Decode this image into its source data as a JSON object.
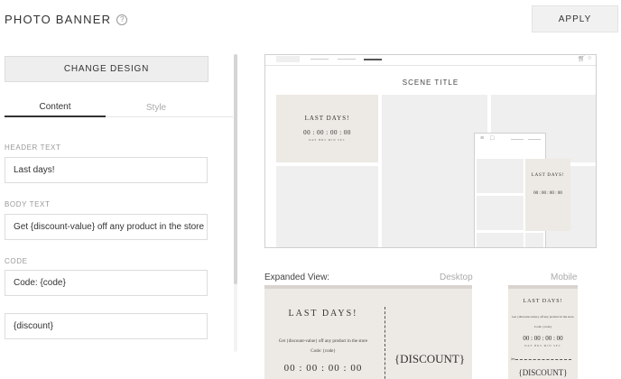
{
  "header": {
    "title": "PHOTO BANNER",
    "help_icon": "?",
    "apply_label": "APPLY"
  },
  "left_panel": {
    "change_design_label": "CHANGE DESIGN",
    "tabs": [
      {
        "label": "Content",
        "active": true
      },
      {
        "label": "Style",
        "active": false
      }
    ],
    "fields": {
      "header_text": {
        "label": "HEADER TEXT",
        "value": "Last days!"
      },
      "body_text": {
        "label": "BODY TEXT",
        "value": "Get {discount-value} off any product in the store"
      },
      "code": {
        "label": "CODE",
        "value": "Code: {code}"
      },
      "discount": {
        "value": "{discount}"
      }
    }
  },
  "preview": {
    "scene_title": "SCENE TITLE",
    "banner": {
      "heading": "LAST DAYS!",
      "countdown": "00 : 00 : 00 : 00",
      "countdown_units": "DAY  HRS  MIN  SEC"
    },
    "mobile_banner": {
      "heading": "LAST DAYS!",
      "countdown": "00 : 00 : 00 : 00"
    }
  },
  "expanded": {
    "label": "Expanded View:",
    "desktop_label": "Desktop",
    "mobile_label": "Mobile",
    "desktop": {
      "heading": "LAST DAYS!",
      "body": "Get {discount-value} off any product in the store",
      "code": "Code: {code}",
      "countdown": "00 : 00 : 00 : 00",
      "discount": "{DISCOUNT}"
    },
    "mobile": {
      "heading": "LAST DAYS!",
      "body": "Get {discount-value} off any product in the store",
      "code": "Code: {code}",
      "countdown": "00 : 00 : 00 : 00",
      "countdown_units": "DAY  HRS  MIN  SEC",
      "discount": "{DISCOUNT}"
    }
  }
}
